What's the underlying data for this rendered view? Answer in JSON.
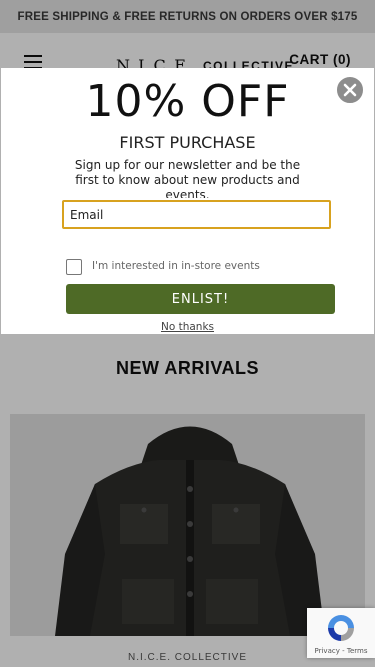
{
  "announcement": {
    "text": "FREE SHIPPING & FREE RETURNS ON ORDERS OVER $175"
  },
  "header": {
    "menu_icon": "hamburger-menu-icon",
    "logo_main": "N.I.C.E.",
    "logo_sub": "COLLECTIVE",
    "cart_label": "CART (0)"
  },
  "main": {
    "section_title": "NEW ARRIVALS",
    "product": {
      "brand": "N.I.C.E. COLLECTIVE"
    }
  },
  "popup": {
    "headline": "10% OFF",
    "subheadline": "FIRST PURCHASE",
    "body": "Sign up for our newsletter and be the first to know about new products and events.",
    "email_placeholder": "Email",
    "checkbox_label": "I'm interested in in-store events",
    "cta_label": "ENLIST!",
    "dismiss_label": "No thanks",
    "close_icon": "close-icon"
  },
  "recaptcha": {
    "privacy": "Privacy",
    "separator": " - ",
    "terms": "Terms"
  },
  "colors": {
    "cta": "#4e6a26",
    "input_focus": "#d8a21f",
    "overlay": "rgba(0,0,0,0.31)",
    "announcement_bg": "#e6e6e6"
  }
}
